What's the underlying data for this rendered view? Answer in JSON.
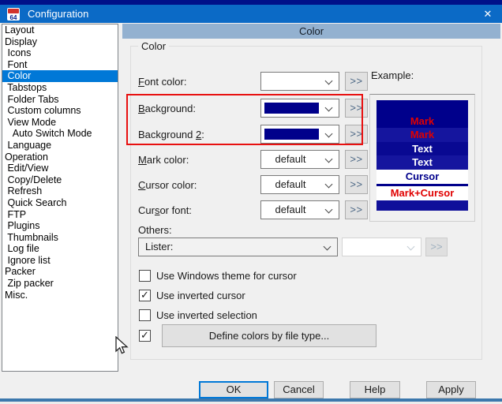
{
  "titlebar": {
    "title": "Configuration",
    "icon_text": "64",
    "close_glyph": "✕"
  },
  "colors": {
    "titlebar": "#0b6ac6",
    "titlebar_top": "#001089",
    "header_bar": "#93b1d0",
    "selection": "#0078d7",
    "swatch_navy": "#00008b",
    "annotation": "#e81010",
    "bottom_edge": "#3c78ad"
  },
  "sidebar": {
    "items": [
      {
        "label": "Layout",
        "selected": false
      },
      {
        "label": "Display",
        "selected": false
      },
      {
        "label": " Icons",
        "selected": false
      },
      {
        "label": " Font",
        "selected": false
      },
      {
        "label": " Color",
        "selected": true
      },
      {
        "label": " Tabstops",
        "selected": false
      },
      {
        "label": " Folder Tabs",
        "selected": false
      },
      {
        "label": " Custom columns",
        "selected": false
      },
      {
        "label": " View Mode",
        "selected": false
      },
      {
        "label": "   Auto Switch Mode",
        "selected": false
      },
      {
        "label": " Language",
        "selected": false
      },
      {
        "label": "Operation",
        "selected": false
      },
      {
        "label": " Edit/View",
        "selected": false
      },
      {
        "label": " Copy/Delete",
        "selected": false
      },
      {
        "label": " Refresh",
        "selected": false
      },
      {
        "label": " Quick Search",
        "selected": false
      },
      {
        "label": " FTP",
        "selected": false
      },
      {
        "label": " Plugins",
        "selected": false
      },
      {
        "label": " Thumbnails",
        "selected": false
      },
      {
        "label": " Log file",
        "selected": false
      },
      {
        "label": " Ignore list",
        "selected": false
      },
      {
        "label": "Packer",
        "selected": false
      },
      {
        "label": " Zip packer",
        "selected": false
      },
      {
        "label": "Misc.",
        "selected": false
      }
    ]
  },
  "header": {
    "title": "Color"
  },
  "group": {
    "title": "Color"
  },
  "fields": [
    {
      "pre": "",
      "accel": "F",
      "post": "ont color:",
      "value": "",
      "swatch": "",
      "more": ">>",
      "highlighted": false
    },
    {
      "pre": "",
      "accel": "B",
      "post": "ackground:",
      "value": "",
      "swatch": "#00008b",
      "more": ">>",
      "highlighted": true
    },
    {
      "pre": "Background ",
      "accel": "2",
      "post": ":",
      "value": "",
      "swatch": "#00008b",
      "more": ">>",
      "highlighted": true
    },
    {
      "pre": "",
      "accel": "M",
      "post": "ark color:",
      "value": "default",
      "swatch": "",
      "more": ">>",
      "highlighted": false
    },
    {
      "pre": "",
      "accel": "C",
      "post": "ursor color:",
      "value": "default",
      "swatch": "",
      "more": ">>",
      "highlighted": false
    },
    {
      "pre": "Cur",
      "accel": "s",
      "post": "or font:",
      "value": "default",
      "swatch": "",
      "more": ">>",
      "highlighted": false
    }
  ],
  "example": {
    "label": "Example:",
    "rows": [
      {
        "text": "",
        "fg": "#ffffff",
        "bg": "#00008b",
        "sep": false
      },
      {
        "text": "Mark",
        "fg": "#e00000",
        "bg": "#00008b",
        "sep": false
      },
      {
        "text": "Mark",
        "fg": "#e00000",
        "bg": "#15159e",
        "sep": false
      },
      {
        "text": "Text",
        "fg": "#ffffff",
        "bg": "#090992",
        "sep": false
      },
      {
        "text": "Text",
        "fg": "#ffffff",
        "bg": "#15159e",
        "sep": false
      },
      {
        "text": "Cursor",
        "fg": "#00008b",
        "bg": "#ffffff",
        "sep": false
      },
      {
        "text": "Mark+Cursor",
        "fg": "#e00000",
        "bg": "#ffffff",
        "sep": true
      },
      {
        "text": "",
        "fg": "#ffffff",
        "bg": "#10109a",
        "sep": false
      }
    ]
  },
  "others": {
    "label": "Others:",
    "lister_value": "Lister:",
    "disabled_value": "",
    "more": ">>"
  },
  "checkboxes": [
    {
      "label": "Use Windows theme for cursor",
      "checked": false
    },
    {
      "label": "Use inverted cursor",
      "checked": true
    },
    {
      "label": "Use inverted selection",
      "checked": false
    }
  ],
  "define": {
    "checked": true,
    "button_label": "Define colors by file type..."
  },
  "footer": {
    "buttons": [
      {
        "label": "OK",
        "default": true
      },
      {
        "label": "Cancel",
        "default": false
      },
      {
        "label": "Help",
        "default": false
      },
      {
        "label": "Apply",
        "default": false
      }
    ]
  }
}
